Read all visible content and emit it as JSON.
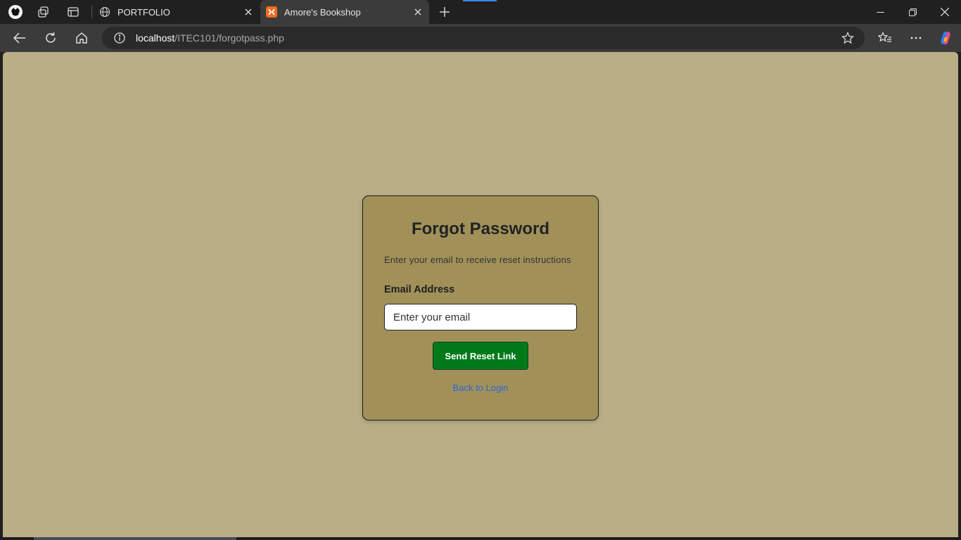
{
  "browser": {
    "tabs": [
      {
        "title": "PORTFOLIO",
        "favicon": "globe-icon",
        "active": false
      },
      {
        "title": "Amore's Bookshop",
        "favicon": "xampp-icon",
        "active": true
      }
    ],
    "address": {
      "host": "localhost",
      "path": "/ITEC101/forgotpass.php"
    }
  },
  "page": {
    "background": "#b9ae85",
    "card": {
      "title": "Forgot Password",
      "subtitle": "Enter your email to receive reset instructions",
      "email_label": "Email Address",
      "email_placeholder": "Enter your email",
      "email_value": "",
      "submit_label": "Send Reset Link",
      "back_link": "Back to Login",
      "colors": {
        "card": "#a19159",
        "button": "#007a1a",
        "link": "#2866d6"
      }
    }
  }
}
